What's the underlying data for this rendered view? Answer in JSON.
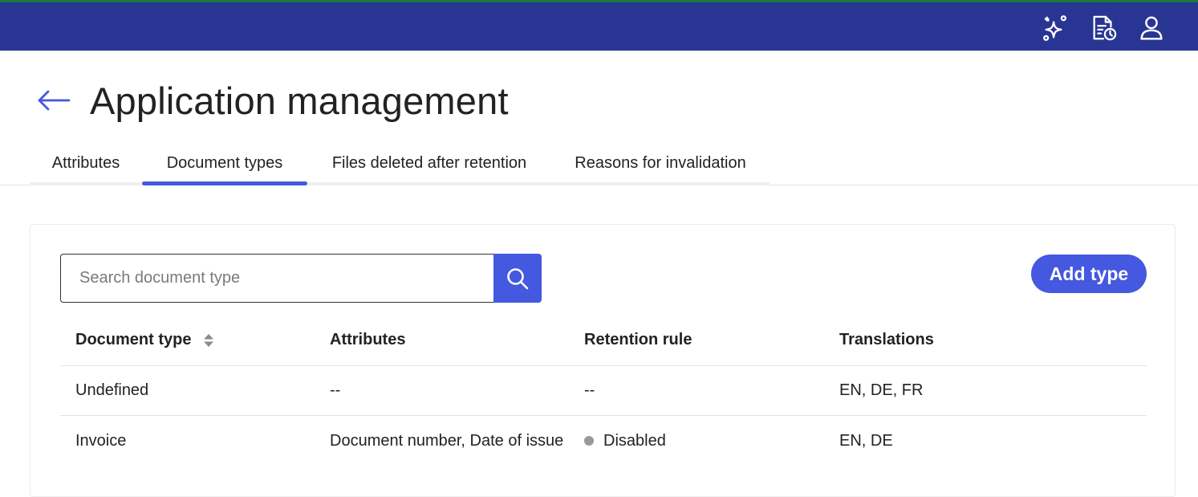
{
  "header": {
    "icons": [
      "sparkles-icon",
      "document-clock-icon",
      "user-icon"
    ]
  },
  "page": {
    "title": "Application management"
  },
  "tabs": [
    {
      "label": "Attributes",
      "active": false
    },
    {
      "label": "Document types",
      "active": true
    },
    {
      "label": "Files deleted after retention",
      "active": false
    },
    {
      "label": "Reasons for invalidation",
      "active": false
    }
  ],
  "search": {
    "placeholder": "Search document type",
    "value": ""
  },
  "actions": {
    "add_label": "Add type"
  },
  "table": {
    "columns": [
      "Document type",
      "Attributes",
      "Retention rule",
      "Translations"
    ],
    "rows": [
      {
        "document_type": "Undefined",
        "attributes": "--",
        "retention_rule": "--",
        "translations": "EN, DE, FR"
      },
      {
        "document_type": "Invoice",
        "attributes": "Document number, Date of issue",
        "retention_rule": "Disabled",
        "translations": "EN, DE"
      }
    ]
  },
  "colors": {
    "header_bg": "#283593",
    "accent": "#4558e0",
    "status_disabled": "#999999"
  }
}
